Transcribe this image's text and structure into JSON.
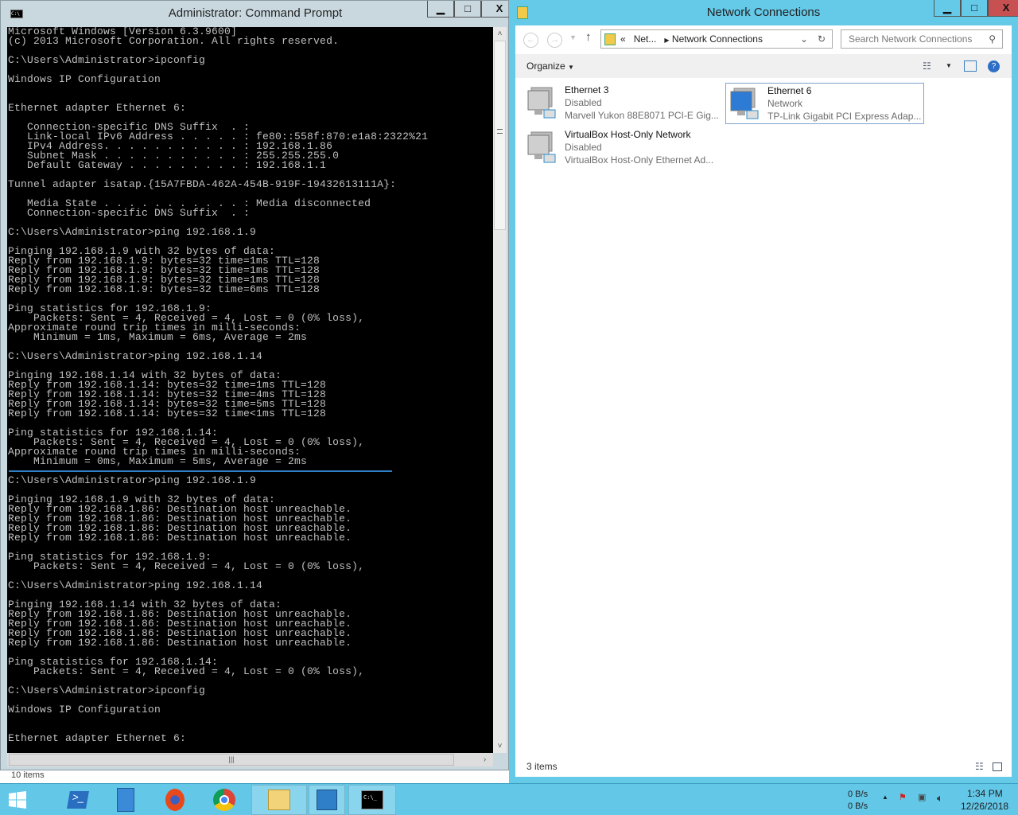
{
  "cmd": {
    "title": "Administrator: Command Prompt",
    "icon": "C:\\",
    "lines": [
      "Microsoft Windows [Version 6.3.9600]",
      "(c) 2013 Microsoft Corporation. All rights reserved.",
      "",
      "C:\\Users\\Administrator>ipconfig",
      "",
      "Windows IP Configuration",
      "",
      "",
      "Ethernet adapter Ethernet 6:",
      "",
      "   Connection-specific DNS Suffix  . :",
      "   Link-local IPv6 Address . . . . . : fe80::558f:870:e1a8:2322%21",
      "   IPv4 Address. . . . . . . . . . . : 192.168.1.86",
      "   Subnet Mask . . . . . . . . . . . : 255.255.255.0",
      "   Default Gateway . . . . . . . . . : 192.168.1.1",
      "",
      "Tunnel adapter isatap.{15A7FBDA-462A-454B-919F-19432613111A}:",
      "",
      "   Media State . . . . . . . . . . . : Media disconnected",
      "   Connection-specific DNS Suffix  . :",
      "",
      "C:\\Users\\Administrator>ping 192.168.1.9",
      "",
      "Pinging 192.168.1.9 with 32 bytes of data:",
      "Reply from 192.168.1.9: bytes=32 time=1ms TTL=128",
      "Reply from 192.168.1.9: bytes=32 time=1ms TTL=128",
      "Reply from 192.168.1.9: bytes=32 time=1ms TTL=128",
      "Reply from 192.168.1.9: bytes=32 time=6ms TTL=128",
      "",
      "Ping statistics for 192.168.1.9:",
      "    Packets: Sent = 4, Received = 4, Lost = 0 (0% loss),",
      "Approximate round trip times in milli-seconds:",
      "    Minimum = 1ms, Maximum = 6ms, Average = 2ms",
      "",
      "C:\\Users\\Administrator>ping 192.168.1.14",
      "",
      "Pinging 192.168.1.14 with 32 bytes of data:",
      "Reply from 192.168.1.14: bytes=32 time=1ms TTL=128",
      "Reply from 192.168.1.14: bytes=32 time=4ms TTL=128",
      "Reply from 192.168.1.14: bytes=32 time=5ms TTL=128",
      "Reply from 192.168.1.14: bytes=32 time<1ms TTL=128",
      "",
      "Ping statistics for 192.168.1.14:",
      "    Packets: Sent = 4, Received = 4, Lost = 0 (0% loss),",
      "Approximate round trip times in milli-seconds:",
      "    Minimum = 0ms, Maximum = 5ms, Average = 2ms",
      "",
      "C:\\Users\\Administrator>ping 192.168.1.9",
      "",
      "Pinging 192.168.1.9 with 32 bytes of data:",
      "Reply from 192.168.1.86: Destination host unreachable.",
      "Reply from 192.168.1.86: Destination host unreachable.",
      "Reply from 192.168.1.86: Destination host unreachable.",
      "Reply from 192.168.1.86: Destination host unreachable.",
      "",
      "Ping statistics for 192.168.1.9:",
      "    Packets: Sent = 4, Received = 4, Lost = 0 (0% loss),",
      "",
      "C:\\Users\\Administrator>ping 192.168.1.14",
      "",
      "Pinging 192.168.1.14 with 32 bytes of data:",
      "Reply from 192.168.1.86: Destination host unreachable.",
      "Reply from 192.168.1.86: Destination host unreachable.",
      "Reply from 192.168.1.86: Destination host unreachable.",
      "Reply from 192.168.1.86: Destination host unreachable.",
      "",
      "Ping statistics for 192.168.1.14:",
      "    Packets: Sent = 4, Received = 4, Lost = 0 (0% loss),",
      "",
      "C:\\Users\\Administrator>ipconfig",
      "",
      "Windows IP Configuration",
      "",
      "",
      "Ethernet adapter Ethernet 6:"
    ]
  },
  "behind_window": {
    "status": "10 items"
  },
  "net": {
    "title": "Network Connections",
    "address": {
      "prefix": "«",
      "crumb1": "Net...",
      "crumb2": "Network Connections"
    },
    "search_placeholder": "Search Network Connections",
    "organize": "Organize",
    "items": [
      {
        "name": "Ethernet 3",
        "status": "Disabled",
        "device": "Marvell Yukon 88E8071 PCI-E Gig..."
      },
      {
        "name": "Ethernet 6",
        "status": "Network",
        "device": "TP-Link Gigabit PCI Express Adap..."
      },
      {
        "name": "VirtualBox Host-Only Network",
        "status": "Disabled",
        "device": "VirtualBox Host-Only Ethernet Ad..."
      }
    ],
    "status": "3 items"
  },
  "taskbar": {
    "net_up": "0 B/s",
    "net_down": "0 B/s",
    "time": "1:34 PM",
    "date": "12/26/2018"
  },
  "colors": {
    "accent": "#65c9e8",
    "console_bg": "#000000",
    "console_fg": "#c0c0c0"
  }
}
